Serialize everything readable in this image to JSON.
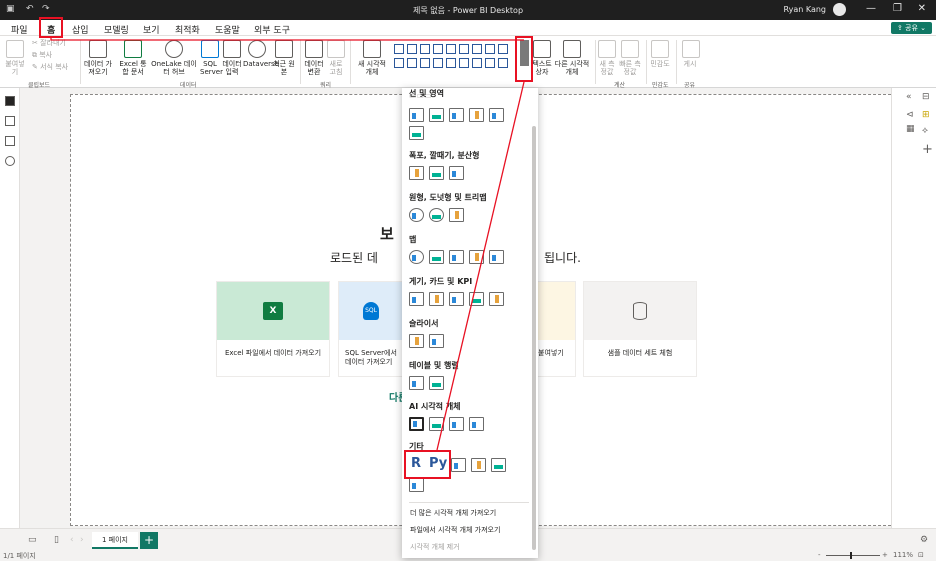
{
  "window": {
    "title": "제목 없음 - Power BI Desktop",
    "user": "Ryan Kang"
  },
  "tabs": [
    "파일",
    "홈",
    "삽입",
    "모델링",
    "보기",
    "최적화",
    "도움말",
    "외부 도구"
  ],
  "share_label": "공유",
  "ribbon": {
    "clipboard": {
      "paste": "붙여넣기",
      "cut": "잘라내기",
      "copy": "복사",
      "format_painter": "서식 복사",
      "group": "클립보드"
    },
    "data": {
      "get_data": "데이터 가져오기",
      "excel": "Excel 통합 문서",
      "onelake": "OneLake 데이터 허브",
      "sql": "SQL Server",
      "enter_data": "데이터 입력",
      "dataverse": "Dataverse",
      "recent": "최근 원본",
      "group": "데이터"
    },
    "queries": {
      "transform": "데이터 변환",
      "refresh": "새로 고침",
      "group": "쿼리"
    },
    "insert": {
      "new_visual": "새 시각적 개체",
      "textbox": "텍스트 상자",
      "more_visuals": "다른 시각적 개체"
    },
    "calculations": {
      "new_measure": "새 측정값",
      "quick_measure": "빠른 측정값",
      "group": "계산"
    },
    "sensitivity": {
      "label": "민감도",
      "group": "민감도"
    },
    "share": {
      "publish": "게시",
      "group": "공유"
    }
  },
  "canvas": {
    "heading_fragment": "보",
    "subtitle_left": "로드된 데",
    "subtitle_right": "됩니다.",
    "cards": [
      {
        "label": "Excel 파일에서 데이터 가져오기",
        "icon": "excel-icon"
      },
      {
        "label": "SQL Server에서 데이터 가져오기",
        "icon": "sql-icon"
      },
      {
        "label": "붙여넣기",
        "icon": "paste-icon"
      },
      {
        "label": "샘플 데이터 세트 체험",
        "icon": "database-icon"
      }
    ],
    "other_link": "다른"
  },
  "dropdown": {
    "sections": [
      "선 및 영역",
      "폭포, 깔때기, 분산형",
      "원형, 도넛형 및 트리맵",
      "맵",
      "게기, 카드 및 KPI",
      "슬라이서",
      "테이블 및 행렬",
      "AI 시각적 개체",
      "기타"
    ],
    "r_label": "R",
    "py_label": "Py",
    "footer_items": [
      "더 많은 시각적 개체 가져오기",
      "파일에서 시각적 개체 가져오기",
      "시각적 개체 제거"
    ]
  },
  "pages": {
    "current": "1 페이지",
    "status": "1/1 페이지",
    "zoom": "111%"
  },
  "colors": {
    "accent": "#117865",
    "highlight": "#e81123"
  }
}
